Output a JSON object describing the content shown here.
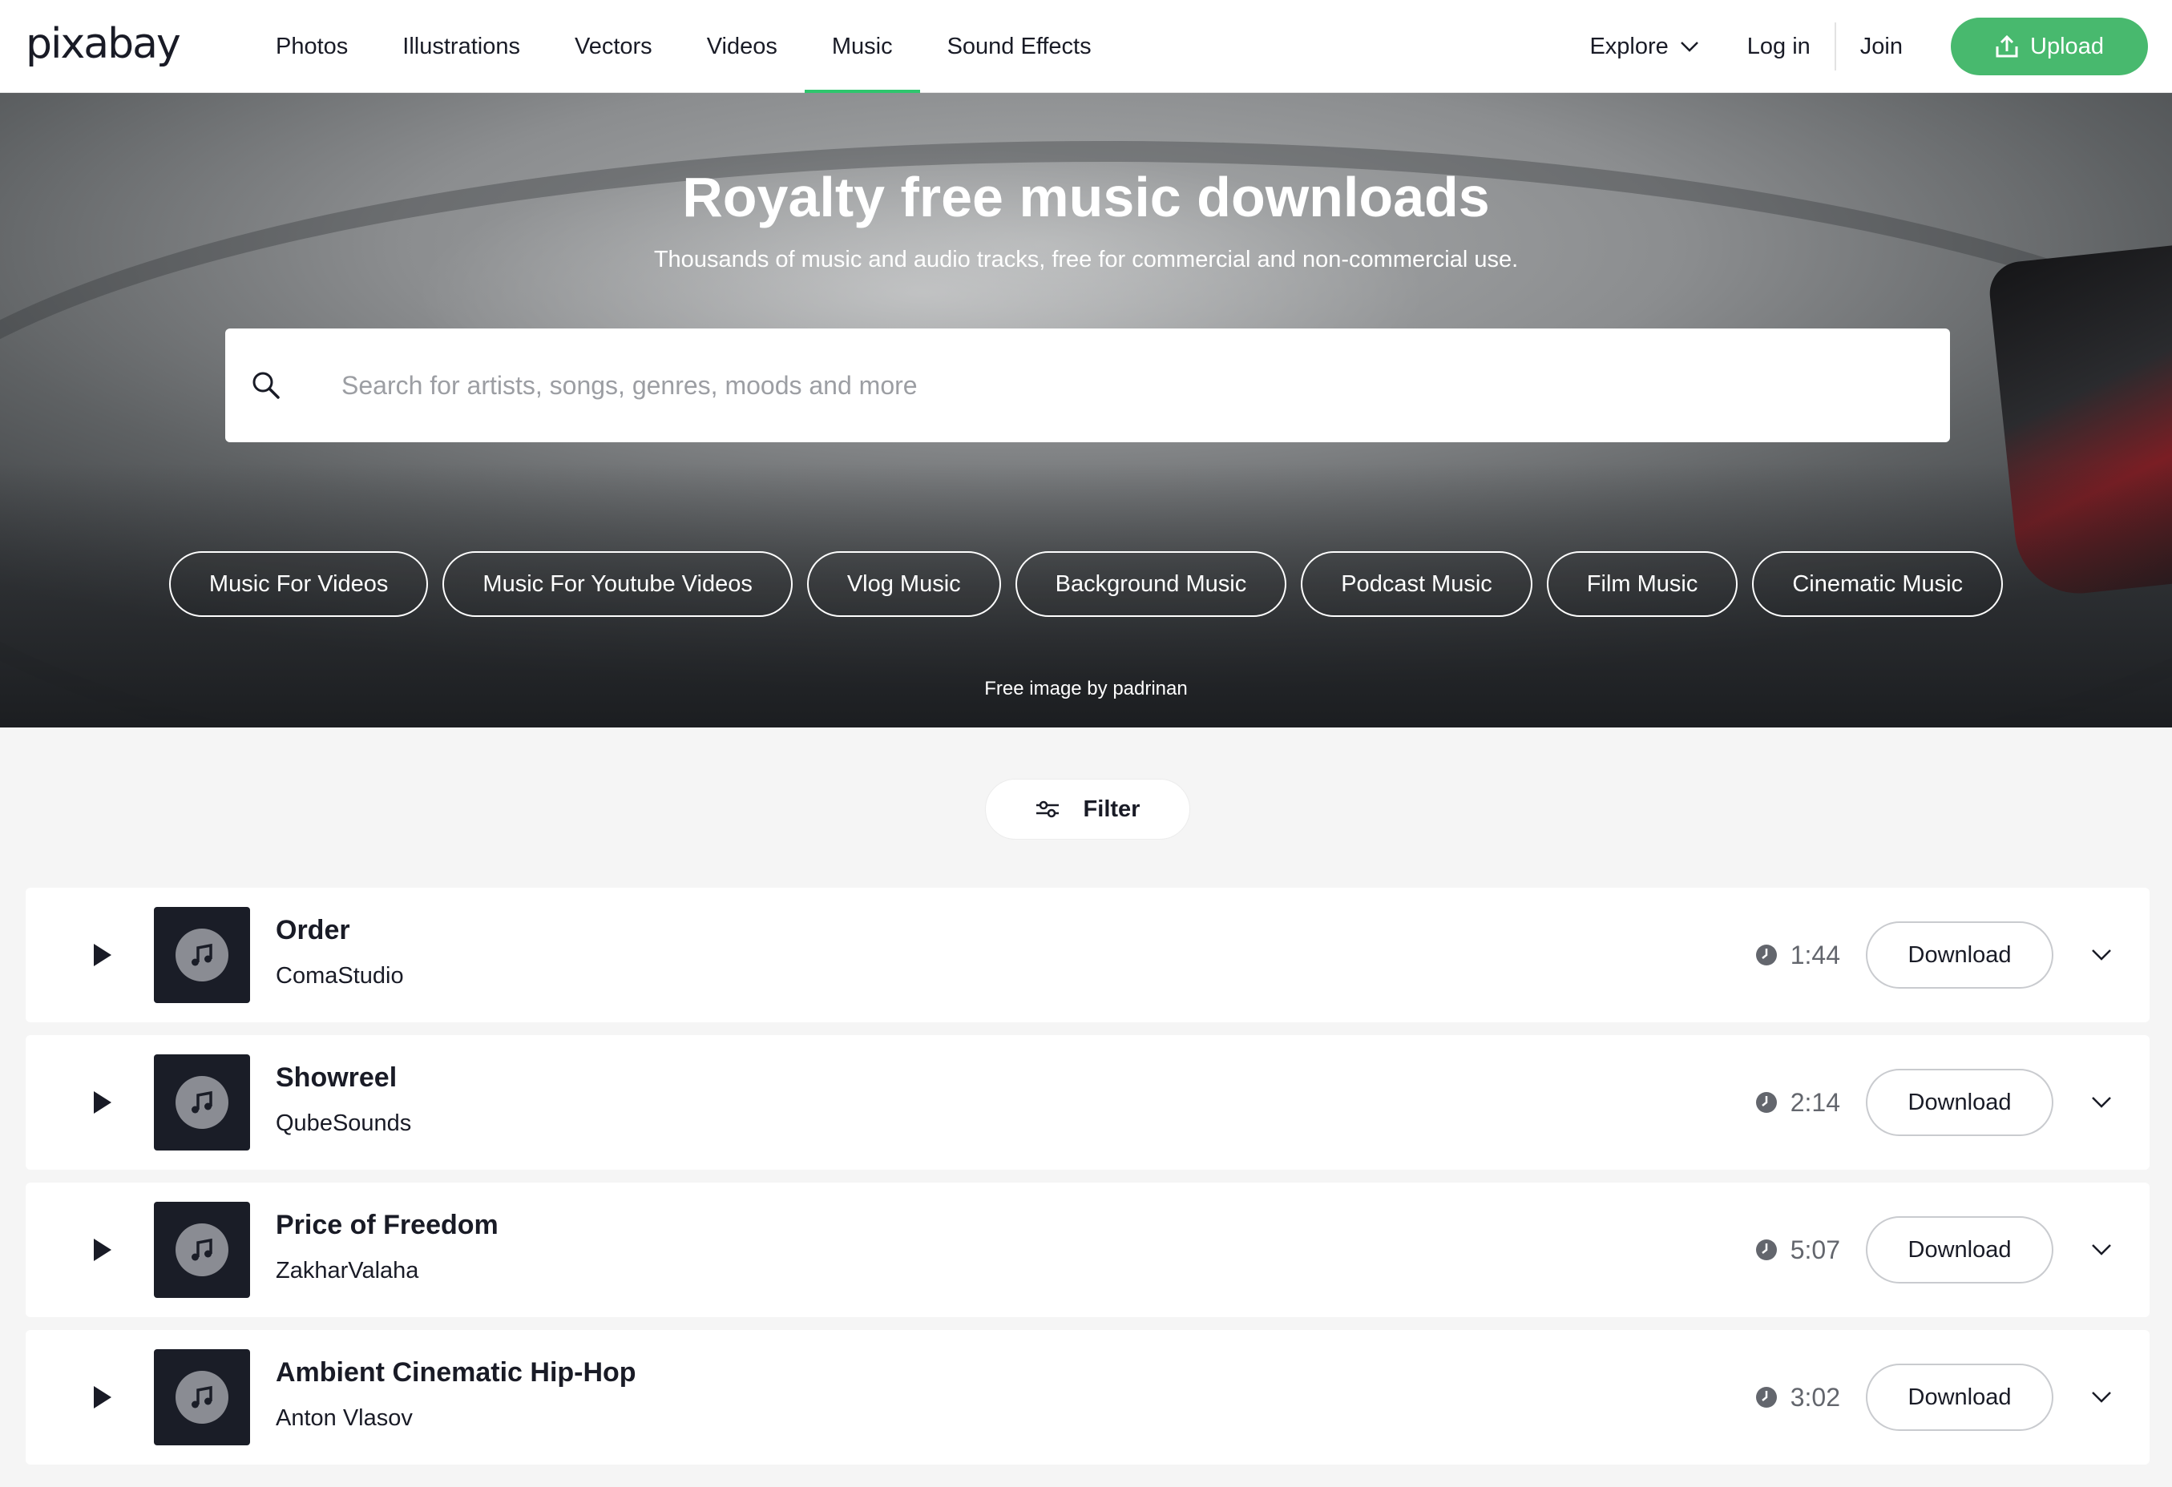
{
  "header": {
    "logo": "pixabay",
    "nav": [
      {
        "label": "Photos",
        "name": "nav-photos"
      },
      {
        "label": "Illustrations",
        "name": "nav-illustrations"
      },
      {
        "label": "Vectors",
        "name": "nav-vectors"
      },
      {
        "label": "Videos",
        "name": "nav-videos"
      },
      {
        "label": "Music",
        "name": "nav-music",
        "active": true
      },
      {
        "label": "Sound Effects",
        "name": "nav-sound-effects"
      }
    ],
    "explore_label": "Explore",
    "login_label": "Log in",
    "join_label": "Join",
    "upload_label": "Upload"
  },
  "hero": {
    "title": "Royalty free music downloads",
    "subtitle": "Thousands of music and audio tracks, free for commercial and non-commercial use.",
    "search_placeholder": "Search for artists, songs, genres, moods and more",
    "search_value": "",
    "chips": [
      "Music For Videos",
      "Music For Youtube Videos",
      "Vlog Music",
      "Background Music",
      "Podcast Music",
      "Film Music",
      "Cinematic Music"
    ],
    "credit": "Free image by padrinan"
  },
  "filter_label": "Filter",
  "download_label": "Download",
  "tracks": [
    {
      "title": "Order",
      "artist": "ComaStudio",
      "duration": "1:44"
    },
    {
      "title": "Showreel",
      "artist": "QubeSounds",
      "duration": "2:14"
    },
    {
      "title": "Price of Freedom",
      "artist": "ZakharValaha",
      "duration": "5:07"
    },
    {
      "title": "Ambient Cinematic Hip-Hop",
      "artist": "Anton Vlasov",
      "duration": "3:02"
    }
  ],
  "colors": {
    "brand_green": "#48b96e",
    "active_underline": "#2ec66d",
    "thumb_bg": "#1a1d27"
  }
}
